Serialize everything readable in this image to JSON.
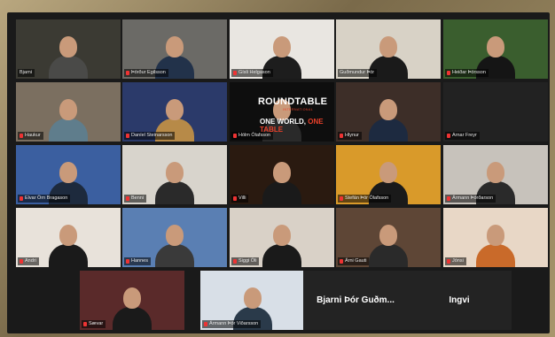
{
  "tiles": [
    {
      "name": "Bjarni",
      "muted": false,
      "bg": "#3b3a33",
      "body": "#4a4a48",
      "active": true
    },
    {
      "name": "Þórður Egilsson",
      "muted": true,
      "bg": "#6b6a66",
      "body": "#22324a"
    },
    {
      "name": "Gísli Helgason",
      "muted": true,
      "bg": "#e9e6e1",
      "body": "#1d1d1d"
    },
    {
      "name": "Guðmundur Þór",
      "muted": false,
      "bg": "#d8d2c6",
      "body": "#1a1a1a"
    },
    {
      "name": "Heiðar Þórsson",
      "muted": true,
      "bg": "#3a5e2e",
      "body": "#151515"
    },
    {
      "name": "Haukur",
      "muted": true,
      "bg": "#7b6f60",
      "body": "#5f7d8c"
    },
    {
      "name": "Daníel Steinarsson",
      "muted": true,
      "bg": "#2b3a6a",
      "body": "#b78a48"
    },
    {
      "name": "Hólm Ólafsson",
      "muted": true,
      "bg": "#0e0e0e",
      "body": "#2a2a2a"
    },
    {
      "name": "Hlynur",
      "muted": true,
      "bg": "#3d2e28",
      "body": "#1d2a40"
    },
    {
      "name": "Arnar Freyr",
      "muted": true,
      "bg": "#222222",
      "body": "#222222",
      "empty": true
    },
    {
      "name": "Elvar Örn Bragason",
      "muted": true,
      "bg": "#3b5fa0",
      "body": "#1d2a3d"
    },
    {
      "name": "Benni",
      "muted": true,
      "bg": "#d8d4cc",
      "body": "#2a2a2a"
    },
    {
      "name": "Villi",
      "muted": true,
      "bg": "#2a1a10",
      "body": "#1a1a1a"
    },
    {
      "name": "Stefán Þór Ólafsson",
      "muted": true,
      "bg": "#d99a2a",
      "body": "#1a1a1a"
    },
    {
      "name": "Ármann Þórðarson",
      "muted": true,
      "bg": "#c7c2bb",
      "body": "#2a2a2a"
    },
    {
      "name": "Andri",
      "muted": true,
      "bg": "#e8e2da",
      "body": "#1a1a1a"
    },
    {
      "name": "Hannes",
      "muted": true,
      "bg": "#5a7fb3",
      "body": "#3a3a3a"
    },
    {
      "name": "Siggi Óli",
      "muted": true,
      "bg": "#d9d1c7",
      "body": "#1a1a1a"
    },
    {
      "name": "Árni Gauti",
      "muted": true,
      "bg": "#5e4636",
      "body": "#2a2a2a"
    },
    {
      "name": "Jónsi",
      "muted": true,
      "bg": "#e8d7c6",
      "body": "#c96a2a"
    },
    {
      "name": "Sævar",
      "muted": true,
      "bg": "#5a2a2a",
      "body": "#1a1a1a"
    },
    {
      "name": "Ármann Þór Viðarsson",
      "muted": true,
      "bg": "#d8dfe7",
      "body": "#2a3a4a"
    }
  ],
  "name_only_tiles": [
    {
      "label": "Bjarni Þór Guðm..."
    },
    {
      "label": "Ingvi"
    }
  ],
  "logo": {
    "main": "ROUNDTABLE",
    "international": "INTERNATIONAL",
    "tagline_a": "ONE WORLD,",
    "tagline_b": "ONE TABLE"
  }
}
